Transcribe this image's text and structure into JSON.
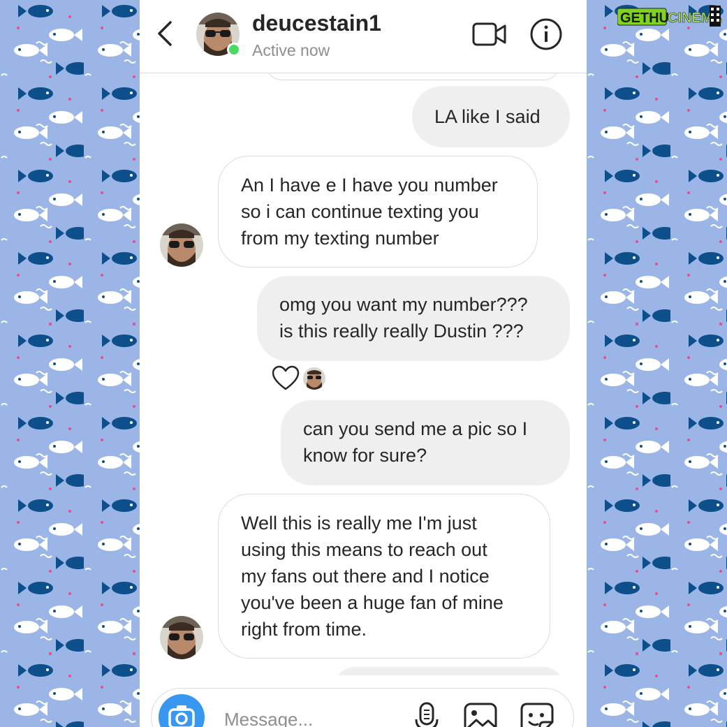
{
  "colors": {
    "background_pattern": "#9bb6e6",
    "fish_dark": "#0d4f8b",
    "fish_light": "#ffffff",
    "dot_pink": "#e6508a",
    "bubble_outgoing": "#efefef",
    "online_green": "#4cd964",
    "camera_blue": "#3897f0"
  },
  "header": {
    "username": "deucestain1",
    "status": "Active now",
    "icons": [
      "back-chevron-icon",
      "video-call-icon",
      "info-icon"
    ]
  },
  "messages": [
    {
      "direction": "outgoing",
      "text": "LA like I said"
    },
    {
      "direction": "incoming",
      "text": "An I have e I have you number\nso i can continue texting you\nfrom my texting number"
    },
    {
      "direction": "outgoing",
      "text": "omg you want my number???\nis this really really Dustin ???",
      "reaction": "heart"
    },
    {
      "direction": "outgoing",
      "text": "can you send me a pic so I\nknow for sure?"
    },
    {
      "direction": "incoming",
      "text": "Well this is really me I'm just\nusing this means to reach out\nmy fans out there and I notice\nyou've been a huge fan of mine\nright from time."
    }
  ],
  "composer": {
    "placeholder": "Message...",
    "icons": [
      "camera-icon",
      "microphone-icon",
      "gallery-icon",
      "sticker-icon"
    ]
  },
  "watermark": {
    "text_a": "GETHU",
    "text_b": "CINEMA"
  }
}
